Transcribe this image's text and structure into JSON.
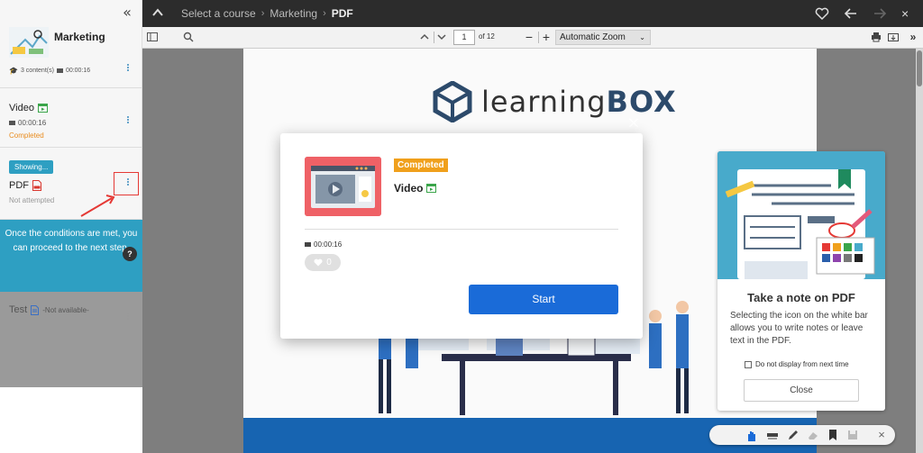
{
  "sidebar": {
    "course": {
      "title": "Marketing",
      "contents": "3 content(s)",
      "duration": "00:00:16"
    },
    "items": [
      {
        "title": "Video",
        "duration": "00:00:16",
        "status": "Completed",
        "status_color": "#e98c1e"
      },
      {
        "badge": "Showing...",
        "title": "PDF",
        "status": "Not attempted"
      }
    ],
    "condition_message": "Once the conditions are met, you can proceed to the next step.",
    "help_label": "?",
    "test": {
      "title": "Test",
      "availability": "-Not available-"
    }
  },
  "topbar": {
    "breadcrumbs": [
      "Select a course",
      "Marketing",
      "PDF"
    ]
  },
  "pdf_toolbar": {
    "page_current": "1",
    "page_total": "of 12",
    "zoom": "Automatic Zoom"
  },
  "pdf_page": {
    "brand_light": "learning",
    "brand_bold": "BOX"
  },
  "note_card": {
    "title": "Take a note on PDF",
    "description": "Selecting the icon on the white bar allows you to write notes or leave text in the PDF.",
    "checkbox_label": "Do not display from next time",
    "close_label": "Close"
  },
  "modal": {
    "badge": "Completed",
    "title": "Video",
    "duration": "00:00:16",
    "likes": "0",
    "start_label": "Start",
    "close_glyph": "×"
  },
  "colors": {
    "accent": "#2e9fc2",
    "primary_button": "#1a6bd8",
    "badge_completed": "#f0a01c",
    "highlight": "#e53935"
  }
}
